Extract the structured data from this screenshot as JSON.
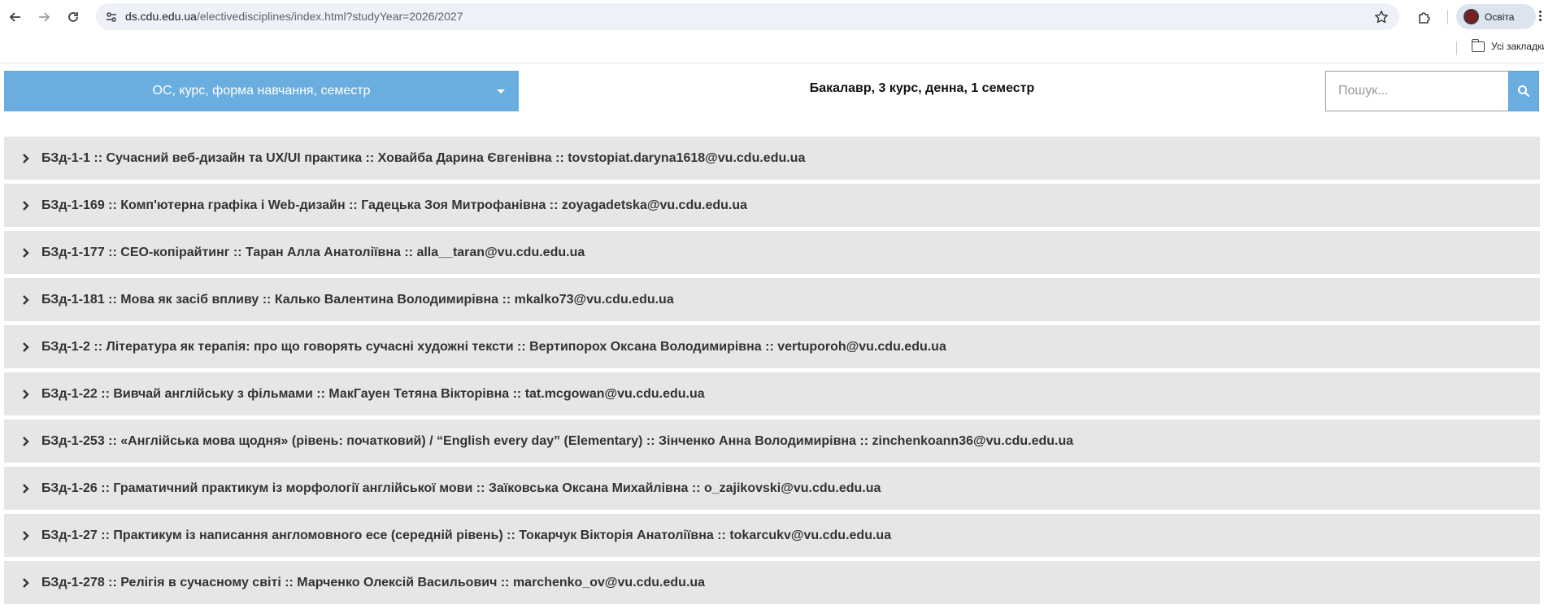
{
  "browser": {
    "url_host": "ds.cdu.edu.ua",
    "url_path": "/electivedisciplines/index.html?studyYear=2026/2027",
    "profile_name": "Освіта",
    "bookmarks_folder": "Усі закладки"
  },
  "page": {
    "filter_label": "ОС, курс, форма навчання, семестр",
    "current_selection": "Бакалавр, 3 курс, денна, 1 семестр",
    "search_placeholder": "Пошук..."
  },
  "disciplines": [
    {
      "label": "БЗд-1-1 :: Сучасний веб-дизайн та UX/UI практика :: Ховайба Дарина Євгенівна :: tovstopiat.daryna1618@vu.cdu.edu.ua"
    },
    {
      "label": "БЗд-1-169 :: Комп'ютерна графіка і Web-дизайн :: Гадецька Зоя Митрофанівна :: zoyagadetska@vu.cdu.edu.ua"
    },
    {
      "label": "БЗд-1-177 :: СЕО-копірайтинг :: Таран Алла Анатоліївна :: alla__taran@vu.cdu.edu.ua"
    },
    {
      "label": "БЗд-1-181 :: Мова як засіб впливу :: Калько Валентина Володимирівна :: mkalko73@vu.cdu.edu.ua"
    },
    {
      "label": "БЗд-1-2 :: Література як терапія: про що говорять сучасні художні тексти :: Вертипорох Оксана Володимирівна :: vertuporoh@vu.cdu.edu.ua"
    },
    {
      "label": "БЗд-1-22 :: Вивчай англійську з фільмами :: МакГауен Тетяна Вікторівна :: tat.mcgowan@vu.cdu.edu.ua"
    },
    {
      "label": "БЗд-1-253 :: «Англійська мова щодня» (рівень: початковий) / “English every day” (Elementary) :: Зінченко Анна Володимирівна :: zinchenkoann36@vu.cdu.edu.ua"
    },
    {
      "label": "БЗд-1-26 :: Граматичний практикум із морфології англійської мови :: Заїковська Оксана Михайлівна :: o_zajikovski@vu.cdu.edu.ua"
    },
    {
      "label": "БЗд-1-27 :: Практикум із написання англомовного есе (середній рівень) :: Токарчук Вікторія Анатоліївна :: tokarcukv@vu.cdu.edu.ua"
    },
    {
      "label": "БЗд-1-278 :: Релігія в сучасному світі :: Марченко Олексій Васильович :: marchenko_ov@vu.cdu.edu.ua"
    }
  ]
}
